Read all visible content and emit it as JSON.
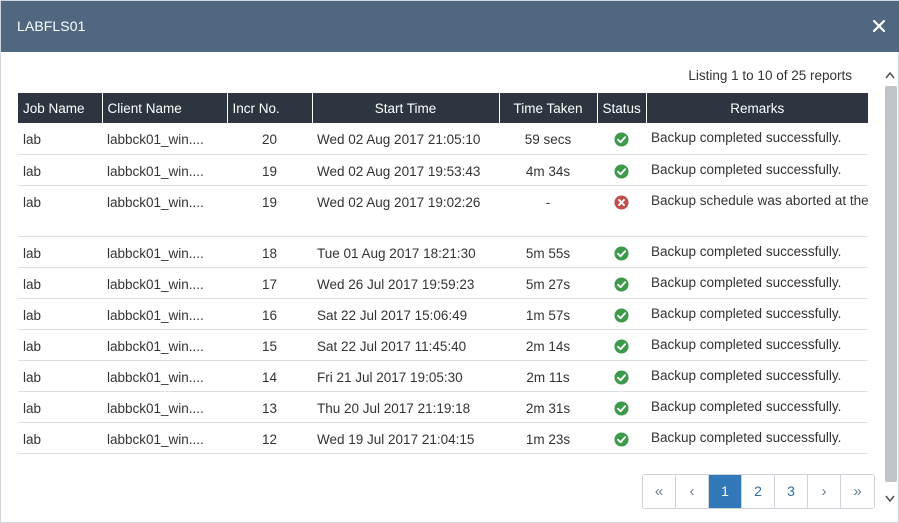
{
  "dialog": {
    "title": "LABFLS01",
    "close_glyph": "×"
  },
  "listing_text": "Listing 1 to 10 of 25 reports",
  "columns": {
    "job_name": "Job Name",
    "client_name": "Client Name",
    "incr_no": "Incr No.",
    "start_time": "Start Time",
    "time_taken": "Time Taken",
    "status": "Status",
    "remarks": "Remarks"
  },
  "rows": [
    {
      "job": "lab",
      "client": "labbck01_win....",
      "incr": "20",
      "start": "Wed 02 Aug 2017 21:05:10",
      "taken": "59 secs",
      "status": "success",
      "remarks": "Backup completed successfully."
    },
    {
      "job": "lab",
      "client": "labbck01_win....",
      "incr": "19",
      "start": "Wed 02 Aug 2017 19:53:43",
      "taken": "4m 34s",
      "status": "success",
      "remarks": "Backup completed successfully."
    },
    {
      "job": "lab",
      "client": "labbck01_win....",
      "incr": "19",
      "start": "Wed 02 Aug 2017 19:02:26",
      "taken": "-",
      "status": "error",
      "remarks": "Backup schedule was aborted at the ..."
    },
    {
      "job": "lab",
      "client": "labbck01_win....",
      "incr": "18",
      "start": "Tue 01 Aug 2017 18:21:30",
      "taken": "5m 55s",
      "status": "success",
      "remarks": "Backup completed successfully."
    },
    {
      "job": "lab",
      "client": "labbck01_win....",
      "incr": "17",
      "start": "Wed 26 Jul 2017 19:59:23",
      "taken": "5m 27s",
      "status": "success",
      "remarks": "Backup completed successfully."
    },
    {
      "job": "lab",
      "client": "labbck01_win....",
      "incr": "16",
      "start": "Sat 22 Jul 2017 15:06:49",
      "taken": "1m 57s",
      "status": "success",
      "remarks": "Backup completed successfully."
    },
    {
      "job": "lab",
      "client": "labbck01_win....",
      "incr": "15",
      "start": "Sat 22 Jul 2017 11:45:40",
      "taken": "2m 14s",
      "status": "success",
      "remarks": "Backup completed successfully."
    },
    {
      "job": "lab",
      "client": "labbck01_win....",
      "incr": "14",
      "start": "Fri 21 Jul 2017 19:05:30",
      "taken": "2m 11s",
      "status": "success",
      "remarks": "Backup completed successfully."
    },
    {
      "job": "lab",
      "client": "labbck01_win....",
      "incr": "13",
      "start": "Thu 20 Jul 2017 21:19:18",
      "taken": "2m 31s",
      "status": "success",
      "remarks": "Backup completed successfully."
    },
    {
      "job": "lab",
      "client": "labbck01_win....",
      "incr": "12",
      "start": "Wed 19 Jul 2017 21:04:15",
      "taken": "1m 23s",
      "status": "success",
      "remarks": "Backup completed successfully."
    }
  ],
  "status_icons": {
    "success": "check-circle-icon",
    "error": "x-circle-icon"
  },
  "colors": {
    "header_bg": "#4f6781",
    "table_header_bg": "#2c3540",
    "success": "#3d9a4b",
    "error": "#c0504d",
    "active_page": "#3178b8"
  },
  "pagination": {
    "first": "«",
    "prev": "‹",
    "pages": [
      "1",
      "2",
      "3"
    ],
    "current": "1",
    "next": "›",
    "last": "»"
  }
}
